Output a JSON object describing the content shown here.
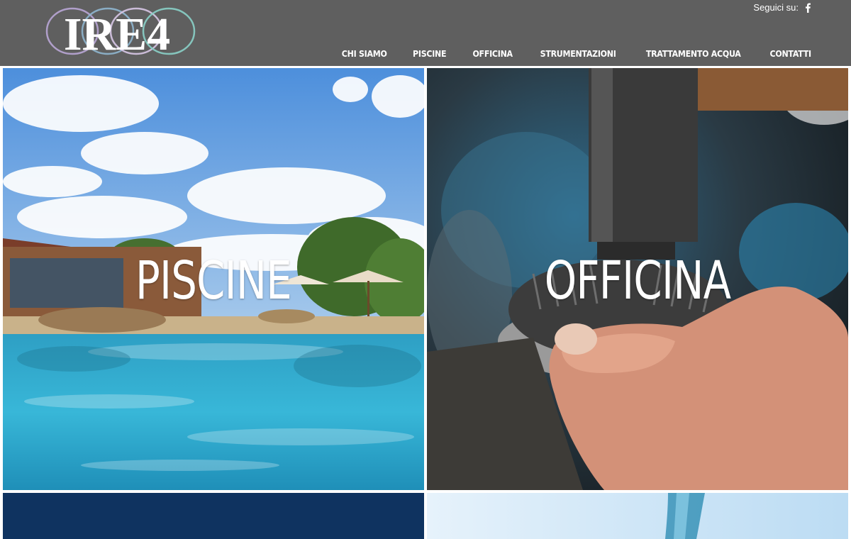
{
  "header": {
    "logo_text": "IRE4",
    "social_label": "Seguici su:",
    "social_icon": "facebook-icon"
  },
  "nav": {
    "items": [
      {
        "label": "CHI SIAMO"
      },
      {
        "label": "PISCINE"
      },
      {
        "label": "OFFICINA"
      },
      {
        "label": "STRUMENTAZIONI"
      },
      {
        "label": "TRATTAMENTO ACQUA"
      },
      {
        "label": "CONTATTI"
      }
    ]
  },
  "tiles": [
    {
      "label": "PISCINE"
    },
    {
      "label": "OFFICINA"
    }
  ],
  "colors": {
    "header_bg": "#5f5f5f",
    "tile_blue": "#0f3360",
    "text": "#ffffff"
  }
}
